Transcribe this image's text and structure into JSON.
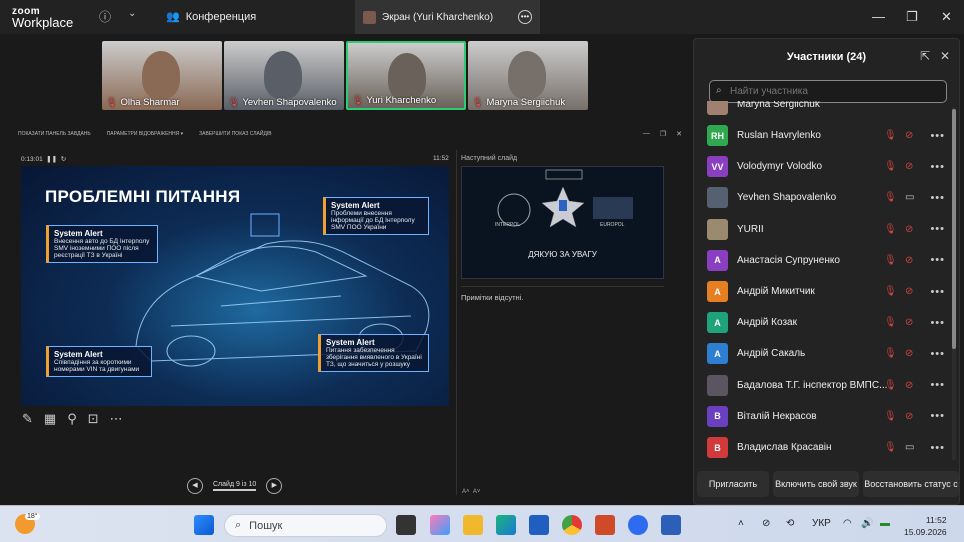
{
  "app": {
    "logo_top": "zoom",
    "logo_bottom": "Workplace",
    "conference_label": "Конференция",
    "screen_tab_label": "Экран (Yuri Kharchenko)"
  },
  "thumbnails": [
    {
      "name": "Olha Sharmar",
      "bg": "#8a6a55"
    },
    {
      "name": "Yevhen Shapovalenko",
      "bg": "#5a5e66"
    },
    {
      "name": "Yuri Kharchenko",
      "bg": "#6a625a"
    },
    {
      "name": "Maryna Sergiichuk",
      "bg": "#77706a"
    }
  ],
  "presenter": {
    "top_buttons": [
      "ПОКАЗАТИ ПАНЕЛЬ ЗАВДАНЬ",
      "ПАРАМЕТРИ ВІДОБРАЖЕННЯ ▾",
      "ЗАВЕРШИТИ ПОКАЗ СЛАЙДІВ"
    ],
    "timer": "0:13:01",
    "clock": "11:52",
    "next_slide_label": "Наступний слайд",
    "next_slide_text": "ДЯКУЮ ЗА УВАГУ",
    "next_logos": [
      "INTERPOL",
      "EUROPOL"
    ],
    "notes": "Примітки відсутні.",
    "slide_counter": "Слайд 9 із 10"
  },
  "slide": {
    "title": "ПРОБЛЕМНІ ПИТАННЯ",
    "alerts": [
      {
        "head": "System Alert",
        "body": "Внесення авто до БД Інтерполу SMV іноземними ПОО після реєстрації ТЗ в Україні"
      },
      {
        "head": "System Alert",
        "body": "Проблеми внесення інформації до БД Інтерполу SMV ПОО України"
      },
      {
        "head": "System Alert",
        "body": "Співпадіння за короткими номерами VIN та двигунами"
      },
      {
        "head": "System Alert",
        "body": "Питання забезпечення зберігання виявленого в Україні ТЗ, що значиться у розшуку"
      }
    ]
  },
  "panel": {
    "title": "Участники (24)",
    "search_placeholder": "Найти участника",
    "partial_top": "Maryna Sergiichuk",
    "participants": [
      {
        "name": "Ruslan Havrylenko",
        "initials": "RH",
        "color": "#2fa84f",
        "video": "off"
      },
      {
        "name": "Volodymyr Volodko",
        "initials": "VV",
        "color": "#8a3fc0",
        "video": "off"
      },
      {
        "name": "Yevhen Shapovalenko",
        "initials": "",
        "color": "#556070",
        "video": "on"
      },
      {
        "name": "YURII",
        "initials": "",
        "color": "#9a8a70",
        "video": "off"
      },
      {
        "name": "Анастасія Супруненко",
        "initials": "A",
        "color": "#8a3fc0",
        "video": "off"
      },
      {
        "name": "Андрій  Микитчик",
        "initials": "A",
        "color": "#e67e22",
        "video": "off"
      },
      {
        "name": "Андрій Козак",
        "initials": "A",
        "color": "#1fa37a",
        "video": "off"
      },
      {
        "name": "Андрій Сакаль",
        "initials": "A",
        "color": "#2f7fd0",
        "video": "off"
      },
      {
        "name": "Бадалова Т.Г. інспектор ВМПС...",
        "initials": "",
        "color": "#5a5560",
        "video": "off"
      },
      {
        "name": "Віталій Некрасов",
        "initials": "B",
        "color": "#6a3fc0",
        "video": "off"
      },
      {
        "name": "Владислав Красавін",
        "initials": "B",
        "color": "#d03a3a",
        "video": "on"
      }
    ],
    "footer": {
      "invite": "Пригласить",
      "unmute": "Включить свой звук",
      "restore": "Восстановить статус с"
    }
  },
  "taskbar": {
    "temp": "18°",
    "search": "Пошук",
    "lang": "УКР",
    "time": "11:52",
    "date": "15.09.2026"
  }
}
